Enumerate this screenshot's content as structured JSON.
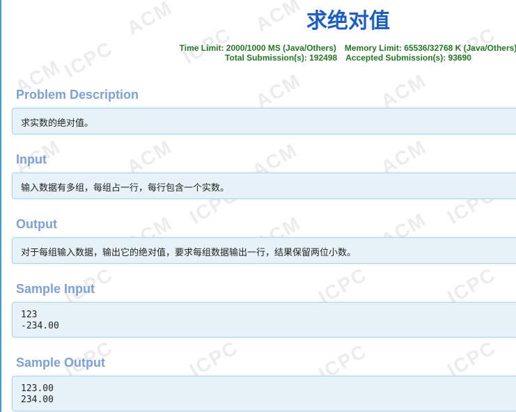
{
  "problem": {
    "title": "求绝对值",
    "time_limit": "Time Limit: 2000/1000 MS (Java/Others)",
    "memory_limit": "Memory Limit: 65536/32768 K (Java/Others)",
    "total_submissions": "Total Submission(s): 192498",
    "accepted_submissions": "Accepted Submission(s): 93690"
  },
  "sections": {
    "description": {
      "heading": "Problem Description",
      "content": "求实数的绝对值。"
    },
    "input": {
      "heading": "Input",
      "content": "输入数据有多组，每组占一行，每行包含一个实数。"
    },
    "output": {
      "heading": "Output",
      "content": "对于每组输入数据，输出它的绝对值，要求每组数据输出一行，结果保留两位小数。"
    },
    "sample_input": {
      "heading": "Sample Input",
      "lines": [
        "123",
        "-234.00"
      ]
    },
    "sample_output": {
      "heading": "Sample Output",
      "lines": [
        "123.00",
        "234.00"
      ]
    }
  },
  "watermark": {
    "texts": [
      "ACM",
      "ICPC"
    ]
  },
  "colors": {
    "title": "#1a5cc8",
    "limits": "#227722",
    "section_heading": "#7ca0d8",
    "panel_bg": "#e6f2f8",
    "panel_border": "#a9d7ec"
  }
}
